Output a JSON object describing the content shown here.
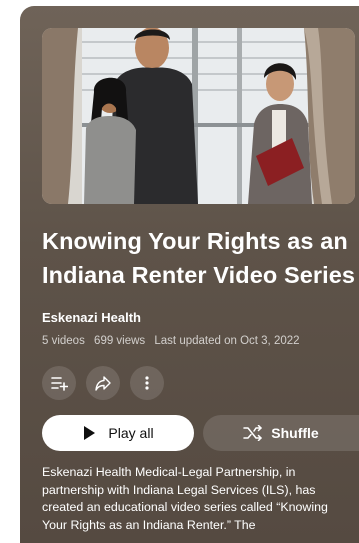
{
  "playlist": {
    "title": "Knowing Your Rights as an Indiana Renter Video Series",
    "channel": "Eskenazi Health",
    "video_count": "5 videos",
    "views": "699 views",
    "updated": "Last updated on Oct 3, 2022",
    "description": "Eskenazi Health Medical-Legal Partnership, in partnership with Indiana Legal Services (ILS), has created an educational video series called “Knowing Your Rights as an Indiana Renter.” The"
  },
  "actions": {
    "play_all_label": "Play all",
    "shuffle_label": "Shuffle",
    "icons": [
      "save-to-library-icon",
      "share-icon",
      "more-options-icon"
    ]
  },
  "colors": {
    "panel_bg": "#5e5349",
    "button_light": "#ffffff",
    "button_dark": "rgba(255,255,255,0.13)"
  }
}
